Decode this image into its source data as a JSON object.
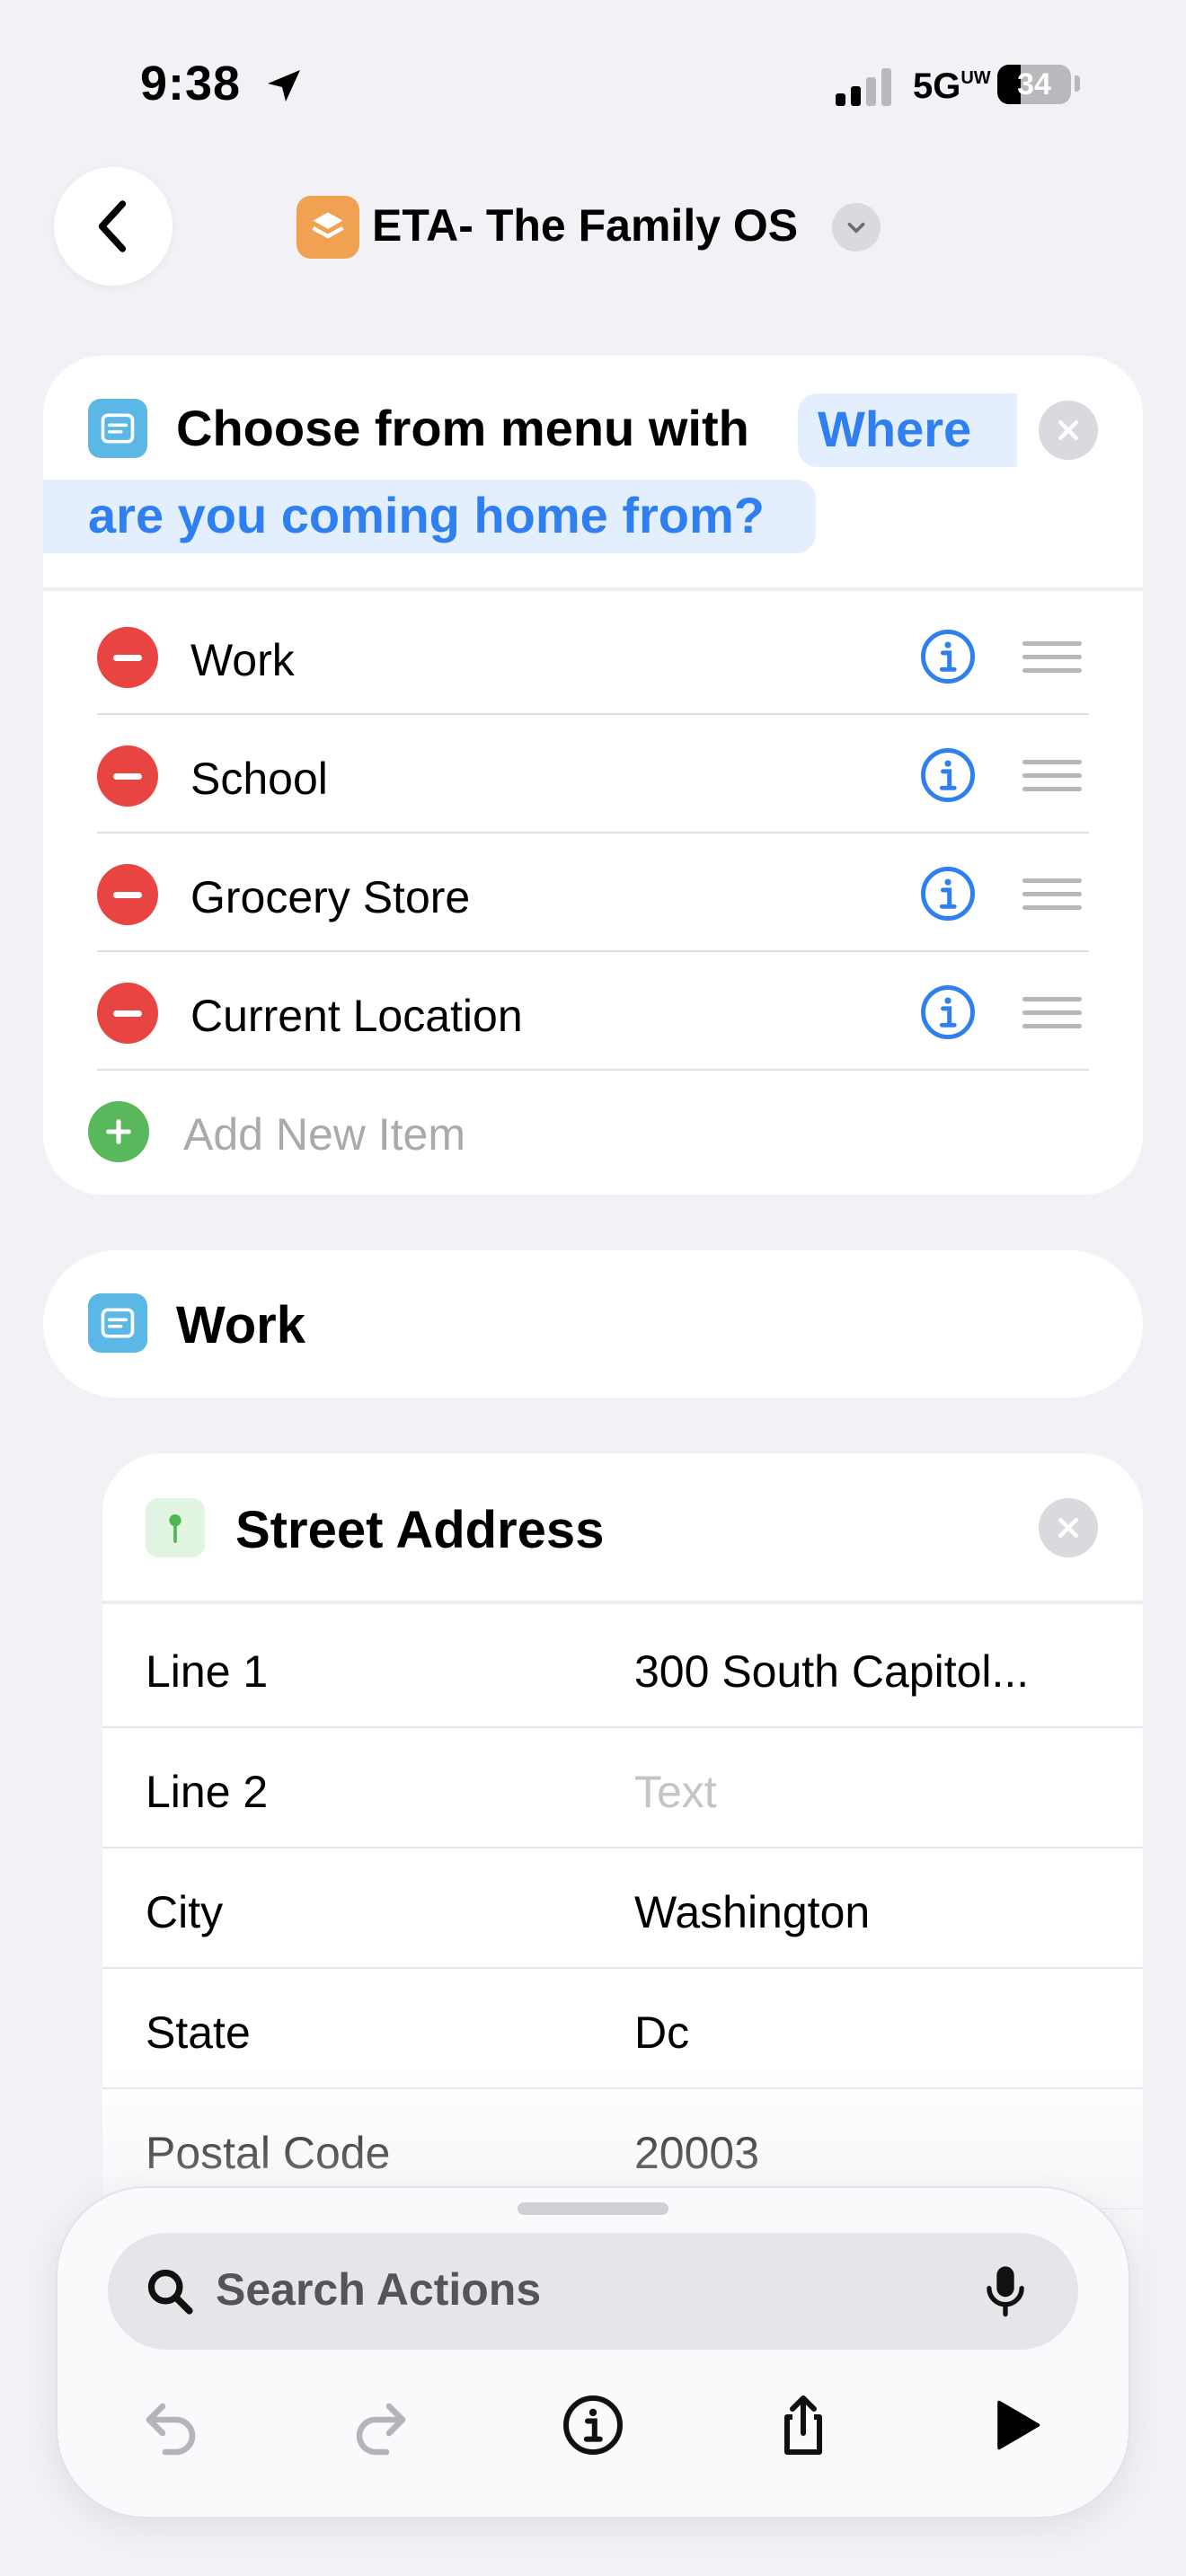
{
  "status_bar": {
    "time": "9:38",
    "network": "5G",
    "network_sup": "UW",
    "battery": "34"
  },
  "header": {
    "shortcut_title": "ETA- The Family OS"
  },
  "menu_action": {
    "label": "Choose from menu with",
    "prompt_part1": "Where",
    "prompt_part2": "are you coming home from?",
    "items": [
      {
        "label": "Work"
      },
      {
        "label": "School"
      },
      {
        "label": "Grocery Store"
      },
      {
        "label": "Current Location"
      }
    ],
    "add_item_label": "Add New Item"
  },
  "work_section": {
    "label": "Work"
  },
  "address_action": {
    "title": "Street Address",
    "fields": [
      {
        "key": "Line 1",
        "value": "300 South Capitol..."
      },
      {
        "key": "Line 2",
        "placeholder": "Text"
      },
      {
        "key": "City",
        "value": "Washington"
      },
      {
        "key": "State",
        "value": "Dc"
      },
      {
        "key": "Postal Code",
        "value": "20003"
      }
    ]
  },
  "bottom_sheet": {
    "search_placeholder": "Search Actions"
  },
  "colors": {
    "accent_blue": "#2f7ff0",
    "delete_red": "#e84441",
    "add_green": "#5ab85c",
    "app_icon_orange": "#f0a152",
    "action_icon_blue": "#5ab7e6"
  },
  "icons": [
    "location-arrow-icon",
    "signal-icon",
    "battery-icon",
    "back-chevron-icon",
    "layers-icon",
    "chevron-down-icon",
    "menu-action-icon",
    "close-icon",
    "minus-icon",
    "info-icon",
    "drag-handle-icon",
    "plus-icon",
    "map-pin-icon",
    "search-icon",
    "microphone-icon",
    "undo-icon",
    "redo-icon",
    "share-icon",
    "play-icon"
  ]
}
